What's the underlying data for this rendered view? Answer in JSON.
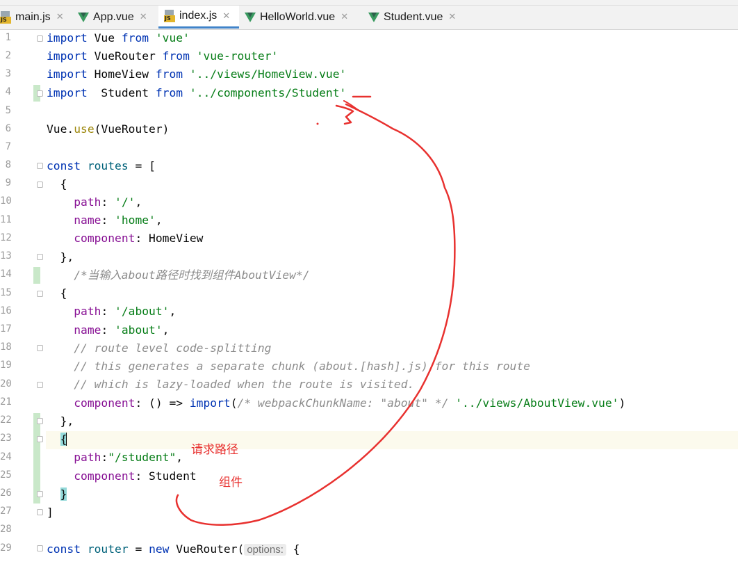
{
  "tabs": [
    {
      "label": "main.js",
      "icon": "js-file-icon"
    },
    {
      "label": "App.vue",
      "icon": "vue-file-icon"
    },
    {
      "label": "index.js",
      "icon": "js-file-icon",
      "active": true
    },
    {
      "label": "HelloWorld.vue",
      "icon": "vue-file-icon"
    },
    {
      "label": "Student.vue",
      "icon": "vue-file-icon"
    }
  ],
  "close_glyph": "✕",
  "js_badge": "JS",
  "line_numbers": [
    "1",
    "2",
    "3",
    "4",
    "5",
    "6",
    "7",
    "8",
    "9",
    "10",
    "11",
    "12",
    "13",
    "14",
    "15",
    "16",
    "17",
    "18",
    "19",
    "20",
    "21",
    "22",
    "23",
    "24",
    "25",
    "26",
    "27",
    "28",
    "29"
  ],
  "code": {
    "l1": [
      "import",
      " Vue ",
      "from",
      " ",
      "'vue'"
    ],
    "l2": [
      "import",
      " VueRouter ",
      "from",
      " ",
      "'vue-router'"
    ],
    "l3": [
      "import",
      " HomeView ",
      "from",
      " ",
      "'../views/HomeView.vue'"
    ],
    "l4": [
      "import",
      "  Student ",
      "from",
      " ",
      "'../components/Student'"
    ],
    "l6": [
      "Vue.",
      "use",
      "(VueRouter)"
    ],
    "l8": [
      "const",
      " ",
      "routes",
      " = ["
    ],
    "l9": "  {",
    "l10": [
      "    ",
      "path",
      ": ",
      "'/'",
      ","
    ],
    "l11": [
      "    ",
      "name",
      ": ",
      "'home'",
      ","
    ],
    "l12": [
      "    ",
      "component",
      ": HomeView"
    ],
    "l13": "  },",
    "l14": "    /*当输入about路径时找到组件AboutView*/",
    "l15": "  {",
    "l16": [
      "    ",
      "path",
      ": ",
      "'/about'",
      ","
    ],
    "l17": [
      "    ",
      "name",
      ": ",
      "'about'",
      ","
    ],
    "l18": "    // route level code-splitting",
    "l19": "    // this generates a separate chunk (about.[hash].js) for this route",
    "l20": "    // which is lazy-loaded when the route is visited.",
    "l21": [
      "    ",
      "component",
      ": () => ",
      "import",
      "(",
      "/* webpackChunkName: \"about\" */",
      " ",
      "'../views/AboutView.vue'",
      ")"
    ],
    "l22": "  },",
    "l23_indent": "  ",
    "l23_brace": "{",
    "l24": [
      "    ",
      "path",
      ":",
      "\"/student\"",
      ","
    ],
    "l25": [
      "    ",
      "component",
      ": Student"
    ],
    "l26_indent": "  ",
    "l26_brace": "}",
    "l27": "]",
    "l29": [
      "const",
      " ",
      "router",
      " = ",
      "new",
      " VueRouter(",
      "options:",
      " {"
    ]
  },
  "annotations": {
    "request_path": "请求路径",
    "component": "组件"
  },
  "colors": {
    "keyword": "#0033b3",
    "string": "#067d17",
    "property": "#871094",
    "comment": "#8c8c8c",
    "annotation": "#e8312f",
    "active_tab_underline": "#4083c9"
  }
}
